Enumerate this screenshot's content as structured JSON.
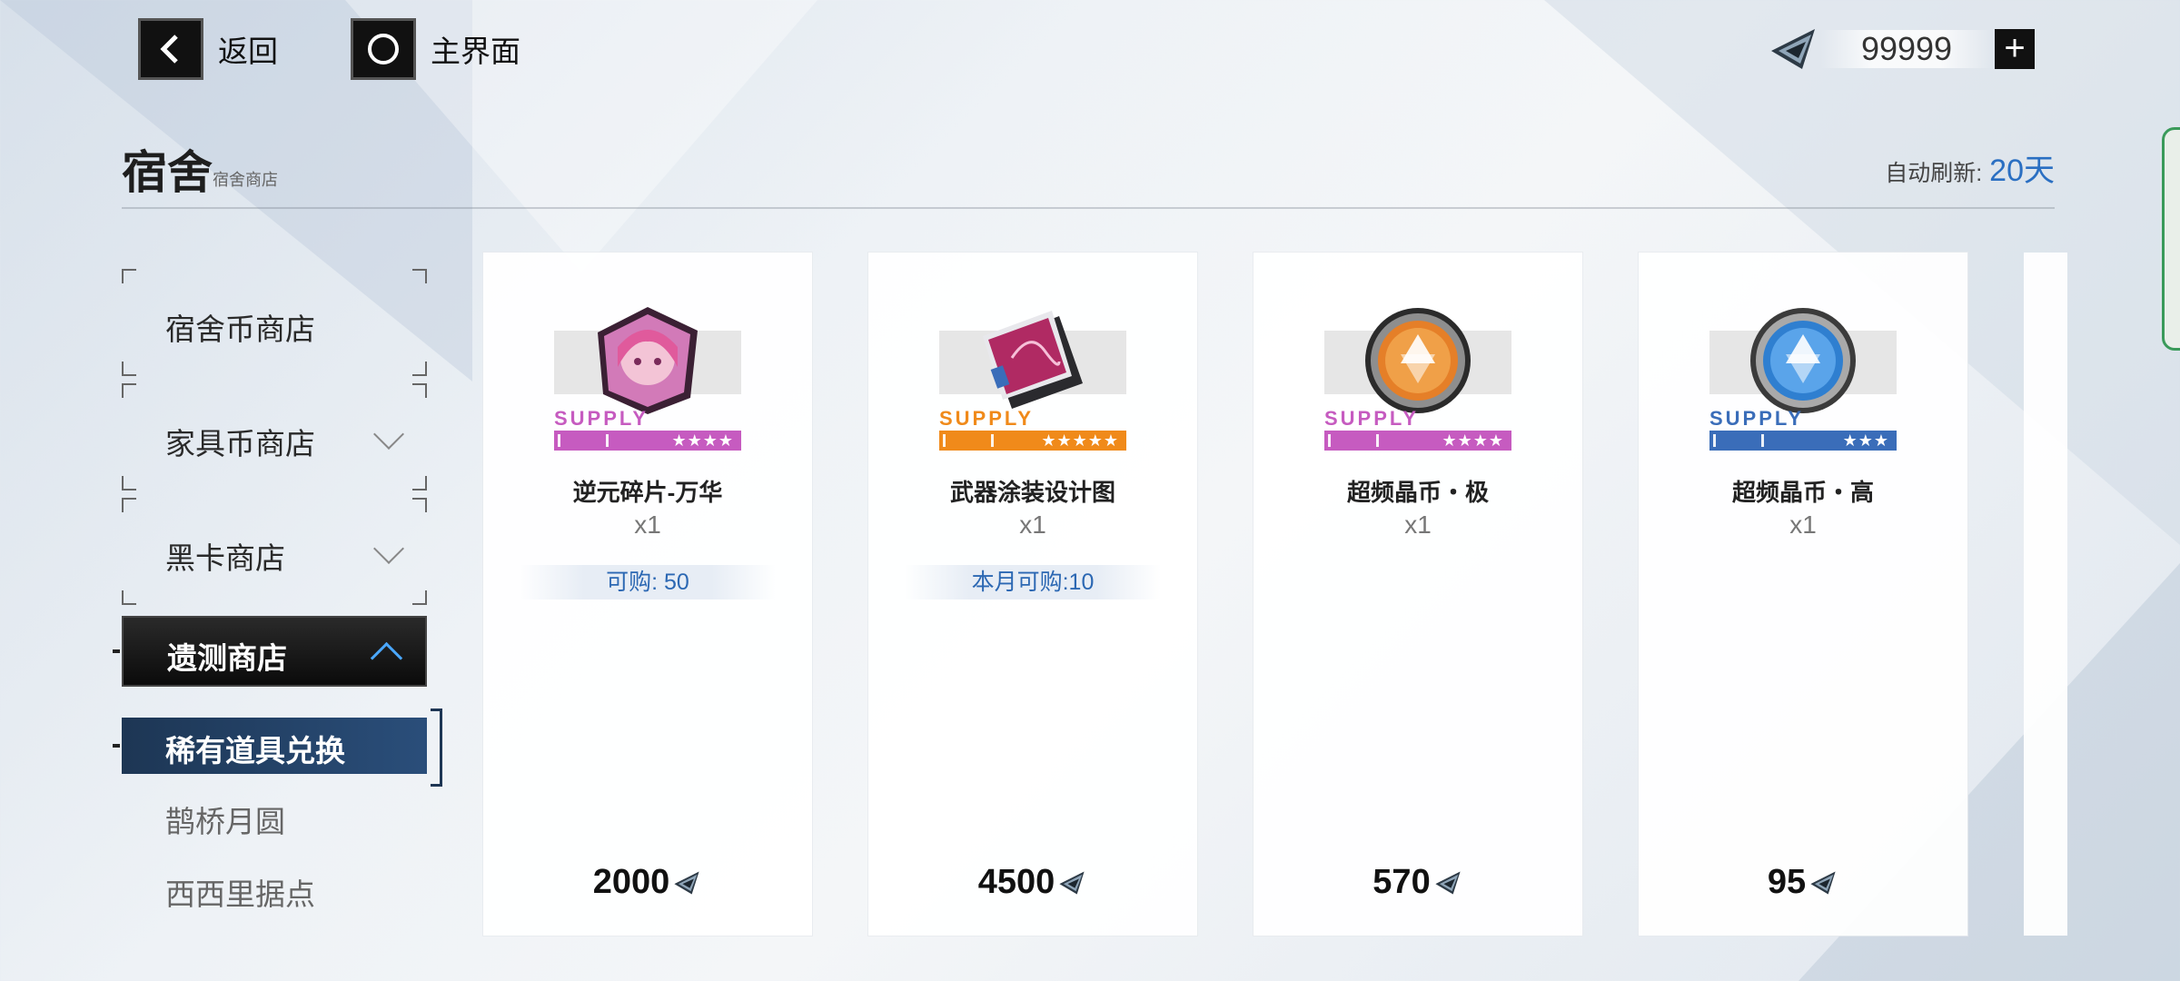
{
  "topbar": {
    "back_label": "返回",
    "home_label": "主界面",
    "currency_icon": "crystal-currency-icon",
    "currency_value": "99999",
    "plus_label": "+"
  },
  "header": {
    "title": "宿舍",
    "subtitle": "宿舍商店",
    "refresh_label": "自动刷新:",
    "refresh_value": "20天"
  },
  "menu": {
    "items": [
      {
        "label": "宿舍币商店"
      },
      {
        "label": "家具币商店"
      },
      {
        "label": "黑卡商店"
      }
    ],
    "active": {
      "label": "遗测商店"
    },
    "subitems": [
      {
        "label": "稀有道具兑换"
      },
      {
        "label": "鹊桥月圆"
      },
      {
        "label": "西西里据点"
      }
    ]
  },
  "colors": {
    "purple": "#c65bc0",
    "orange": "#f08a1a",
    "blue": "#3a6db9",
    "accent_blue": "#2a6fc2"
  },
  "cards": [
    {
      "name": "逆元碎片-万华",
      "qty": "x1",
      "limit": "可购: 50",
      "price": "2000",
      "supply": "SUPPLY",
      "stars": "★★★★",
      "rarity_color": "#c65bc0",
      "icon": "character-fragment-icon"
    },
    {
      "name": "武器涂装设计图",
      "qty": "x1",
      "limit": "本月可购:10",
      "price": "4500",
      "supply": "SUPPLY",
      "stars": "★★★★★",
      "rarity_color": "#f08a1a",
      "icon": "blueprint-icon"
    },
    {
      "name": "超频晶币・极",
      "qty": "x1",
      "price": "570",
      "supply": "SUPPLY",
      "stars": "★★★★",
      "rarity_color": "#c65bc0",
      "icon": "orange-coin-icon"
    },
    {
      "name": "超频晶币・高",
      "qty": "x1",
      "price": "95",
      "supply": "SUPPLY",
      "stars": "★★★",
      "rarity_color": "#3a6db9",
      "icon": "blue-coin-icon"
    }
  ]
}
